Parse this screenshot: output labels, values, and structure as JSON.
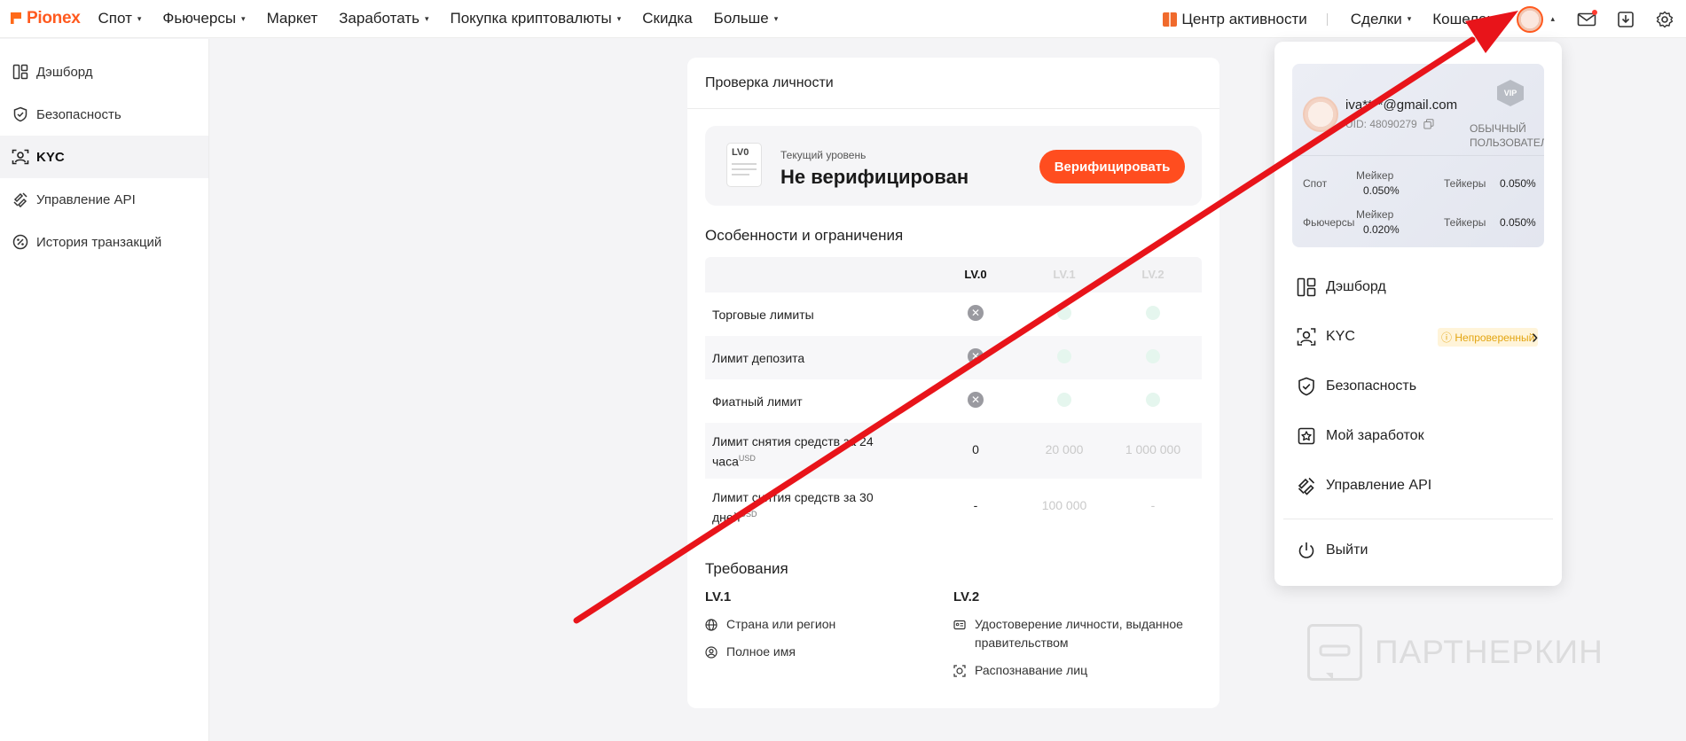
{
  "header": {
    "logo": "Pionex",
    "nav": [
      {
        "label": "Спот",
        "dropdown": true
      },
      {
        "label": "Фьючерсы",
        "dropdown": true
      },
      {
        "label": "Маркет",
        "dropdown": false
      },
      {
        "label": "Заработать",
        "dropdown": true
      },
      {
        "label": "Покупка криптовалюты",
        "dropdown": true
      },
      {
        "label": "Скидка",
        "dropdown": false
      },
      {
        "label": "Больше",
        "dropdown": true
      }
    ],
    "activity": "Центр активности",
    "deals": "Сделки",
    "wallet": "Кошелек",
    "caret": "▾",
    "caret_up": "▴"
  },
  "sidebar": {
    "items": [
      {
        "label": "Дэшборд",
        "icon": "dashboard-icon"
      },
      {
        "label": "Безопасность",
        "icon": "shield-icon"
      },
      {
        "label": "KYC",
        "icon": "kyc-icon",
        "active": true
      },
      {
        "label": "Управление API",
        "icon": "api-icon"
      },
      {
        "label": "История транзакций",
        "icon": "history-icon"
      }
    ]
  },
  "kyc": {
    "title": "Проверка личности",
    "level_badge": "LV0",
    "current_label": "Текущий уровень",
    "current_value": "Не верифицирован",
    "verify_button": "Верифицировать",
    "features_title": "Особенности и ограничения",
    "levels": [
      "LV.0",
      "LV.1",
      "LV.2"
    ],
    "rows": [
      {
        "label": "Торговые лимиты",
        "lv0": "x",
        "lv1": "ok",
        "lv2": "ok"
      },
      {
        "label": "Лимит депозита",
        "lv0": "x",
        "lv1": "ok",
        "lv2": "ok"
      },
      {
        "label": "Фиатный лимит",
        "lv0": "x",
        "lv1": "ok",
        "lv2": "ok"
      },
      {
        "label": "Лимит снятия средств за 24 часа",
        "unit": "USD",
        "lv0": "0",
        "lv1": "20 000",
        "lv2": "1 000 000"
      },
      {
        "label": "Лимит снятия средств за 30 дней",
        "unit": "USD",
        "lv0": "-",
        "lv1": "100 000",
        "lv2": "-"
      }
    ],
    "x_glyph": "✕",
    "requirements_title": "Требования",
    "req_lv1": {
      "title": "LV.1",
      "items": [
        "Страна или регион",
        "Полное имя"
      ]
    },
    "req_lv2": {
      "title": "LV.2",
      "items": [
        "Удостоверение личности, выданное правительством",
        "Распознавание лиц"
      ]
    }
  },
  "dropdown": {
    "email": "iva****@gmail.com",
    "uid": "UID: 48090279",
    "vip_badge": "VIP",
    "user_level_line1": "ОБЫЧНЫЙ",
    "user_level_line2": "ПОЛЬЗОВАТЕЛЬ",
    "fees": [
      {
        "market": "Спот",
        "maker_label": "Мейкер",
        "maker": "0.050%",
        "taker_label": "Тейкеры",
        "taker": "0.050%"
      },
      {
        "market": "Фьючерсы",
        "maker_label": "Мейкер",
        "maker": "0.020%",
        "taker_label": "Тейкеры",
        "taker": "0.050%"
      }
    ],
    "menu": [
      {
        "label": "Дэшборд",
        "icon": "dashboard-icon"
      },
      {
        "label": "KYC",
        "icon": "kyc-icon",
        "badge": "Непроверенный"
      },
      {
        "label": "Безопасность",
        "icon": "shield-icon"
      },
      {
        "label": "Мой заработок",
        "icon": "earnings-icon"
      },
      {
        "label": "Управление API",
        "icon": "api-icon"
      }
    ],
    "logout": "Выйти",
    "badge_icon": "ⓘ",
    "chevron": "›"
  },
  "watermark": "ПАРТНЕРКИН",
  "colors": {
    "brand": "#ff5a1f",
    "annotation_arrow": "#e8141a"
  }
}
